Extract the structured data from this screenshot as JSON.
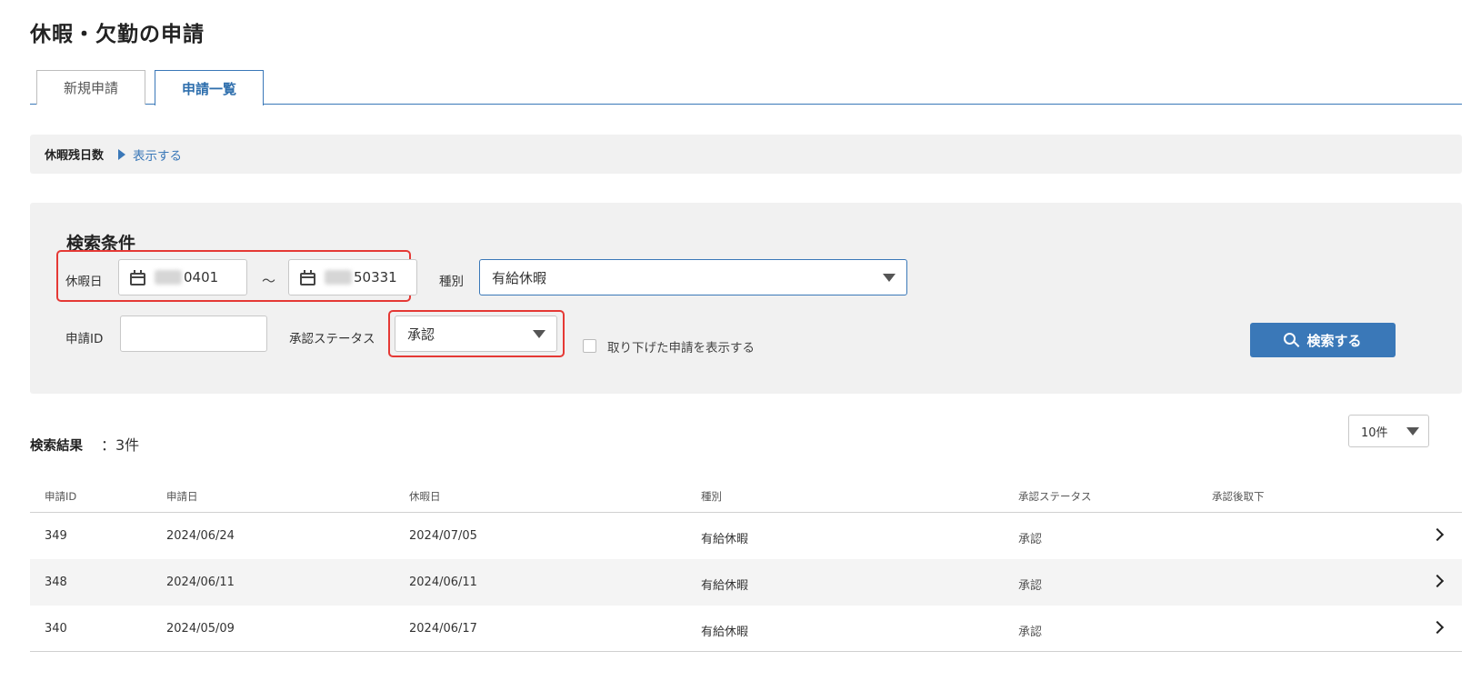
{
  "page": {
    "title": "休暇・欠勤の申請"
  },
  "tabs": [
    {
      "label": "新規申請"
    },
    {
      "label": "申請一覧"
    }
  ],
  "remaining": {
    "label": "休暇残日数",
    "toggle": "表示する"
  },
  "search": {
    "title": "検索条件",
    "date_label": "休暇日",
    "date_from": "0401",
    "date_to": "50331",
    "date_separator": "～",
    "type_label": "種別",
    "type_value": "有給休暇",
    "id_label": "申請ID",
    "id_value": "",
    "status_label": "承認ステータス",
    "status_value": "承認",
    "withdrawn_label": "取り下げた申請を表示する",
    "withdrawn_checked": false,
    "button": "検索する"
  },
  "results": {
    "label": "検索結果",
    "count": "：3件",
    "per_page": "10件",
    "columns": [
      "申請ID",
      "申請日",
      "休暇日",
      "種別",
      "承認ステータス",
      "承認後取下"
    ],
    "rows": [
      {
        "id": "349",
        "applied": "2024/06/24",
        "leave": "2024/07/05",
        "type": "有給休暇",
        "status": "承認",
        "withdrawn": ""
      },
      {
        "id": "348",
        "applied": "2024/06/11",
        "leave": "2024/06/11",
        "type": "有給休暇",
        "status": "承認",
        "withdrawn": ""
      },
      {
        "id": "340",
        "applied": "2024/05/09",
        "leave": "2024/06/17",
        "type": "有給休暇",
        "status": "承認",
        "withdrawn": ""
      }
    ]
  },
  "colors": {
    "accent": "#3a78b8",
    "highlight": "#e53935",
    "panel": "#f1f1f1"
  }
}
